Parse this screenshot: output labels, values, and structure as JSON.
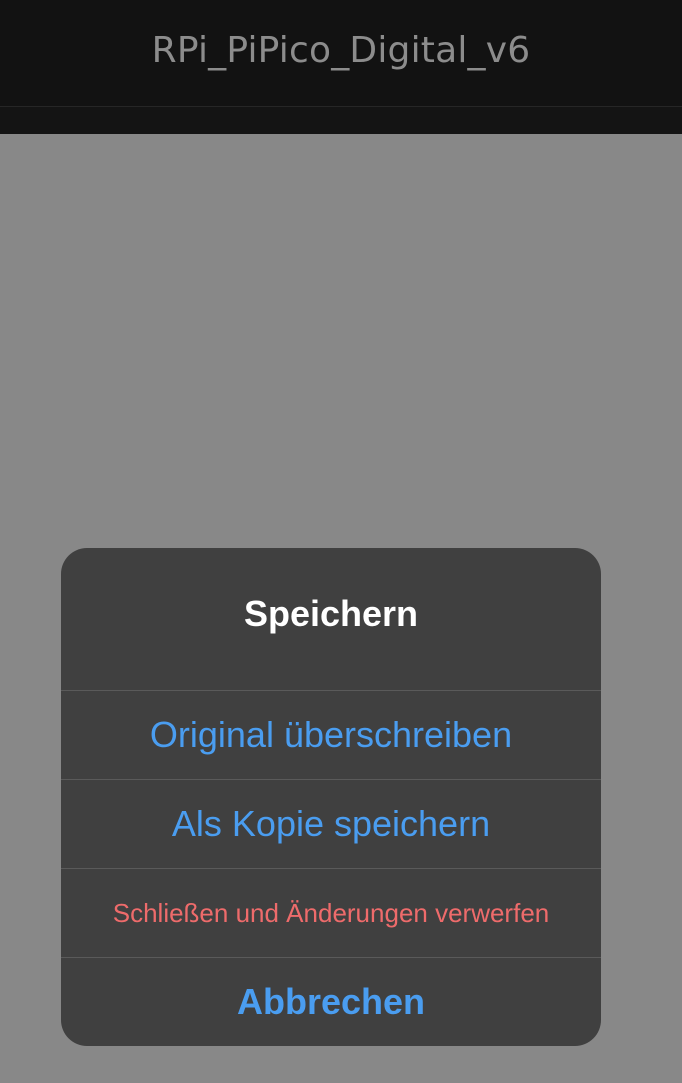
{
  "nav": {
    "title": "RPi_PiPico_Digital_v6"
  },
  "alert": {
    "title": "Speichern",
    "actions": [
      {
        "label": "Original überschreiben",
        "style": "default"
      },
      {
        "label": "Als Kopie speichern",
        "style": "default"
      },
      {
        "label": "Schließen und Änderungen verwerfen",
        "style": "destructive"
      },
      {
        "label": "Abbrechen",
        "style": "cancel"
      }
    ]
  },
  "colors": {
    "nav_background": "#121212",
    "dimmed_background": "#888888",
    "alert_background": "#404040",
    "action_blue": "#4a9df0",
    "destructive_red": "#ee6b6b",
    "title_white": "#ffffff"
  }
}
